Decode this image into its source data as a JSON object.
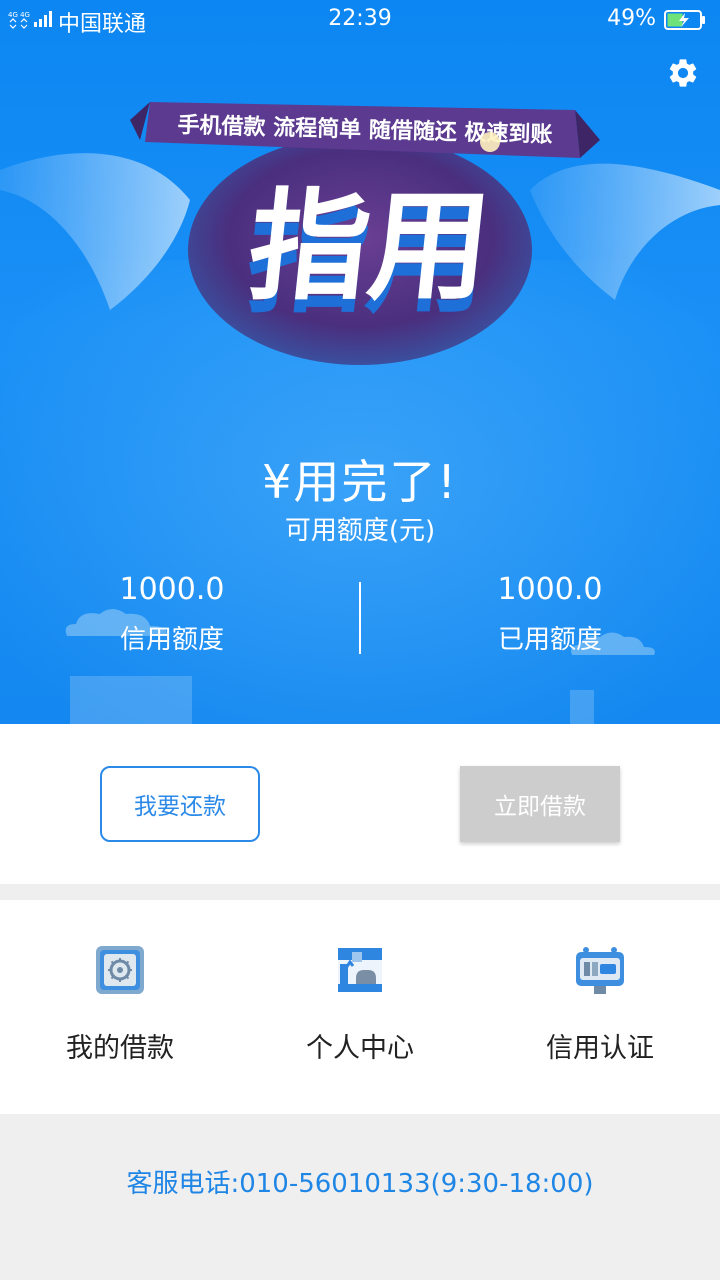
{
  "status_bar": {
    "network": "4G 4G",
    "carrier": "中国联通",
    "time": "22:39",
    "battery": "49%"
  },
  "banner": {
    "slogan": "手机借款 流程简单 随借随还 极速到账",
    "brand": "指用"
  },
  "quota": {
    "available_amount": "¥用完了!",
    "available_label": "可用额度(元)",
    "credit_value": "1000.0",
    "credit_label": "信用额度",
    "used_value": "1000.0",
    "used_label": "已用额度"
  },
  "actions": {
    "repay_label": "我要还款",
    "borrow_label": "立即借款"
  },
  "menu": {
    "items": [
      {
        "label": "我的借款",
        "icon": "safe-icon"
      },
      {
        "label": "个人中心",
        "icon": "person-icon"
      },
      {
        "label": "信用认证",
        "icon": "id-card-icon"
      }
    ]
  },
  "footer": {
    "hotline": "客服电话:010-56010133(9:30-18:00)"
  },
  "colors": {
    "primary": "#1a90f6",
    "accent_text": "#1f86e6",
    "disabled": "#cdcdcd"
  }
}
